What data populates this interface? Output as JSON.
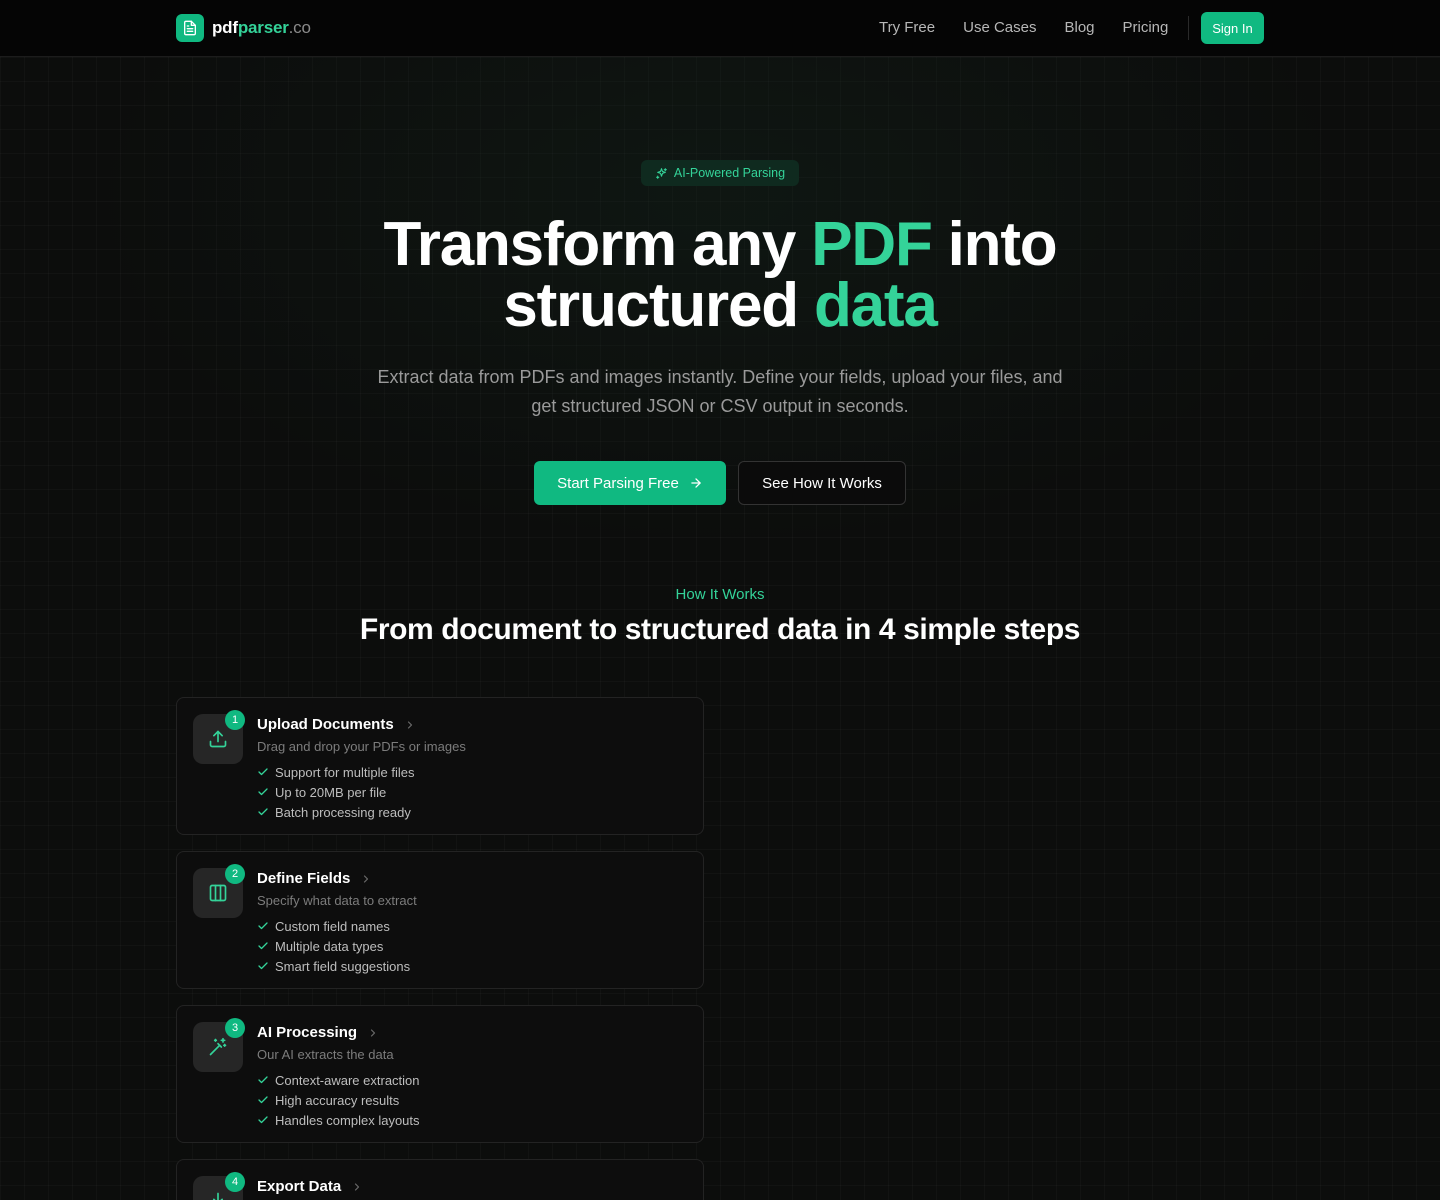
{
  "brand": {
    "part1": "pdf",
    "part2": "parser",
    "part3": ".co"
  },
  "nav": {
    "links": [
      "Try Free",
      "Use Cases",
      "Blog",
      "Pricing"
    ],
    "signin": "Sign In"
  },
  "hero": {
    "badge": "AI-Powered Parsing",
    "title_1": "Transform any ",
    "title_accent_1": "PDF",
    "title_2": " into",
    "title_3": "structured ",
    "title_accent_2": "data",
    "subtitle": "Extract data from PDFs and images instantly. Define your fields, upload your files, and get structured JSON or CSV output in seconds.",
    "cta_primary": "Start Parsing Free",
    "cta_secondary": "See How It Works"
  },
  "how": {
    "eyebrow": "How It Works",
    "title": "From document to structured data in 4 simple steps",
    "steps": [
      {
        "num": "1",
        "icon": "upload-icon",
        "title": "Upload Documents",
        "desc": "Drag and drop your PDFs or images",
        "items": [
          "Support for multiple files",
          "Up to 20MB per file",
          "Batch processing ready"
        ]
      },
      {
        "num": "2",
        "icon": "columns-icon",
        "title": "Define Fields",
        "desc": "Specify what data to extract",
        "items": [
          "Custom field names",
          "Multiple data types",
          "Smart field suggestions"
        ]
      },
      {
        "num": "3",
        "icon": "magic-wand-icon",
        "title": "AI Processing",
        "desc": "Our AI extracts the data",
        "items": [
          "Context-aware extraction",
          "High accuracy results",
          "Handles complex layouts"
        ]
      },
      {
        "num": "4",
        "icon": "download-icon",
        "title": "Export Data",
        "desc": "",
        "items": []
      }
    ]
  },
  "colors": {
    "accent": "#10b981",
    "accent_light": "#34d399",
    "background": "#0b0b0b"
  }
}
